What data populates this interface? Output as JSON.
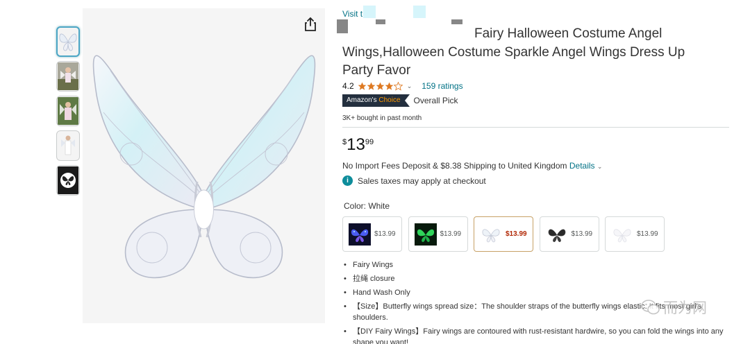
{
  "product": {
    "visit_link": "Visit t",
    "title_line1": "Fairy Halloween Costume Angel",
    "title_line2": "Wings,Halloween Costume Sparkle Angel Wings Dress Up",
    "title_line3": "Party Favor",
    "rating": "4.2",
    "rating_stars": 4.2,
    "ratings_count": "159 ratings",
    "badge_main": "Amazon's",
    "badge_accent": "Choice",
    "badge_label": "Overall Pick",
    "bought": "3K+ bought in past month",
    "price_symbol": "$",
    "price_whole": "13",
    "price_fraction": "99",
    "shipping_text": "No Import Fees Deposit & $8.38 Shipping to United Kingdom",
    "shipping_details": "Details",
    "tax_text": "Sales taxes may apply at checkout",
    "color_label": "Color:",
    "color_value": "White"
  },
  "swatches": [
    {
      "price": "$13.99",
      "icon": "blue-light-wings"
    },
    {
      "price": "$13.99",
      "icon": "green-light-wings"
    },
    {
      "price": "$13.99",
      "icon": "white-wings",
      "selected": true
    },
    {
      "price": "$13.99",
      "icon": "black-wings"
    },
    {
      "price": "$13.99",
      "icon": "pale-white-wings"
    }
  ],
  "bullets": [
    "Fairy Wings",
    "拉绳 closure",
    "Hand Wash Only",
    "【Size】Butterfly wings spread size：The shoulder straps of the butterfly wings elastic. It fits most girl's shoulders.",
    "【DIY Fairy Wings】Fairy wings are contoured with rust-resistant hardwire, so you can fold the wings into any shape you want!"
  ],
  "watermark": "而为网",
  "colors": {
    "link": "#007185",
    "badge_bg": "#232f3e",
    "badge_accent": "#ff9900",
    "selected_price": "#b12704"
  }
}
